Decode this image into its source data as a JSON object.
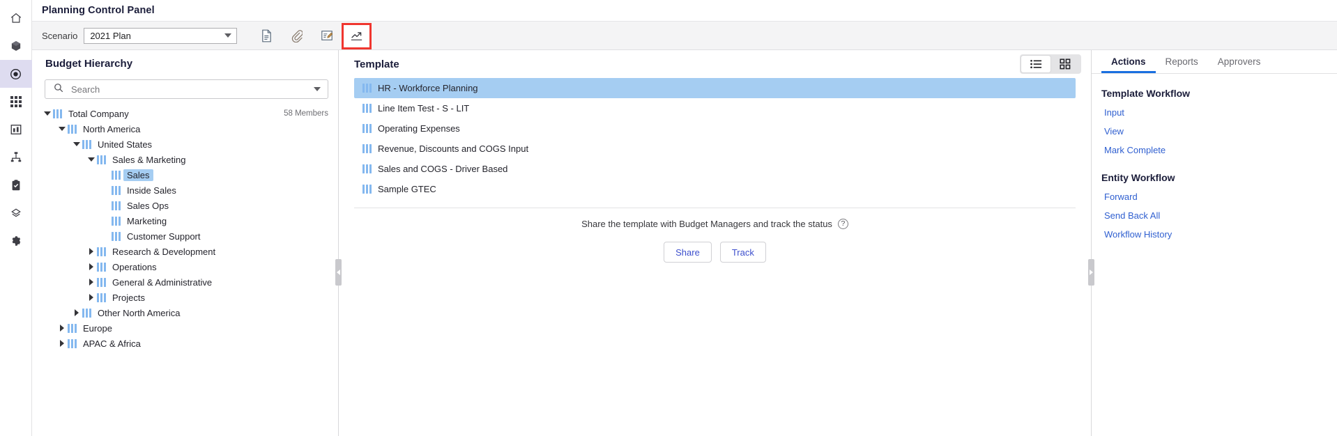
{
  "rail": {
    "items": [
      {
        "name": "home-icon",
        "label": "Home",
        "active": false
      },
      {
        "name": "cube-icon",
        "label": "Models",
        "active": false
      },
      {
        "name": "target-icon",
        "label": "Planning",
        "active": true
      },
      {
        "name": "grid-icon",
        "label": "Grids",
        "active": false
      },
      {
        "name": "bar-chart-icon",
        "label": "Reports",
        "active": false
      },
      {
        "name": "hierarchy-icon",
        "label": "Hierarchy",
        "active": false
      },
      {
        "name": "clipboard-check-icon",
        "label": "Tasks",
        "active": false
      },
      {
        "name": "layers-icon",
        "label": "Layers",
        "active": false
      },
      {
        "name": "gear-icon",
        "label": "Settings",
        "active": false
      }
    ]
  },
  "header": {
    "title": "Planning Control Panel"
  },
  "toolbar": {
    "scenario_label": "Scenario",
    "scenario_value": "2021 Plan",
    "buttons": [
      {
        "name": "document-icon",
        "label": "Document",
        "highlighted": false
      },
      {
        "name": "paperclip-icon",
        "label": "Attachments",
        "highlighted": false
      },
      {
        "name": "edit-note-icon",
        "label": "Notes",
        "highlighted": false
      },
      {
        "name": "trend-chart-icon",
        "label": "Analytics",
        "highlighted": true
      }
    ],
    "highlight_color": "#f0362f"
  },
  "hierarchy": {
    "title": "Budget Hierarchy",
    "search_placeholder": "Search",
    "members_count": "58 Members",
    "tree": [
      {
        "label": "Total Company",
        "depth": 0,
        "twisty": "down",
        "selected": false,
        "members": "58 Members"
      },
      {
        "label": "North America",
        "depth": 1,
        "twisty": "down",
        "selected": false
      },
      {
        "label": "United States",
        "depth": 2,
        "twisty": "down",
        "selected": false
      },
      {
        "label": "Sales & Marketing",
        "depth": 3,
        "twisty": "down",
        "selected": false
      },
      {
        "label": "Sales",
        "depth": 4,
        "twisty": "none",
        "selected": true
      },
      {
        "label": "Inside Sales",
        "depth": 4,
        "twisty": "none",
        "selected": false
      },
      {
        "label": "Sales Ops",
        "depth": 4,
        "twisty": "none",
        "selected": false
      },
      {
        "label": "Marketing",
        "depth": 4,
        "twisty": "none",
        "selected": false
      },
      {
        "label": "Customer Support",
        "depth": 4,
        "twisty": "none",
        "selected": false
      },
      {
        "label": "Research & Development",
        "depth": 3,
        "twisty": "right",
        "selected": false
      },
      {
        "label": "Operations",
        "depth": 3,
        "twisty": "right",
        "selected": false
      },
      {
        "label": "General & Administrative",
        "depth": 3,
        "twisty": "right",
        "selected": false
      },
      {
        "label": "Projects",
        "depth": 3,
        "twisty": "right",
        "selected": false
      },
      {
        "label": "Other North America",
        "depth": 2,
        "twisty": "right",
        "selected": false
      },
      {
        "label": "Europe",
        "depth": 1,
        "twisty": "right",
        "selected": false
      },
      {
        "label": "APAC & Africa",
        "depth": 1,
        "twisty": "right",
        "selected": false
      }
    ]
  },
  "template": {
    "title": "Template",
    "view_list_icon": "list-view-icon",
    "view_grid_icon": "grid-view-icon",
    "active_view": "list",
    "items": [
      {
        "label": "HR - Workforce Planning",
        "selected": true
      },
      {
        "label": "Line Item Test - S - LIT",
        "selected": false
      },
      {
        "label": "Operating Expenses",
        "selected": false
      },
      {
        "label": "Revenue, Discounts and COGS Input",
        "selected": false
      },
      {
        "label": "Sales and COGS - Driver Based",
        "selected": false
      },
      {
        "label": "Sample GTEC",
        "selected": false
      }
    ],
    "share_text": "Share the template with Budget Managers and track the status",
    "help_glyph": "?",
    "share_button": "Share",
    "track_button": "Track"
  },
  "actions": {
    "tabs": [
      {
        "label": "Actions",
        "active": true
      },
      {
        "label": "Reports",
        "active": false
      },
      {
        "label": "Approvers",
        "active": false
      }
    ],
    "groups": [
      {
        "title": "Template Workflow",
        "links": [
          "Input",
          "View",
          "Mark Complete"
        ]
      },
      {
        "title": "Entity Workflow",
        "links": [
          "Forward",
          "Send Back All",
          "Workflow History"
        ]
      }
    ]
  },
  "colors": {
    "accent_blue": "#2f5fd0",
    "selection_blue": "#a5cdf2",
    "tab_underline": "#1a6fe0",
    "highlight_red": "#f0362f",
    "rail_active": "#dedcf0"
  }
}
